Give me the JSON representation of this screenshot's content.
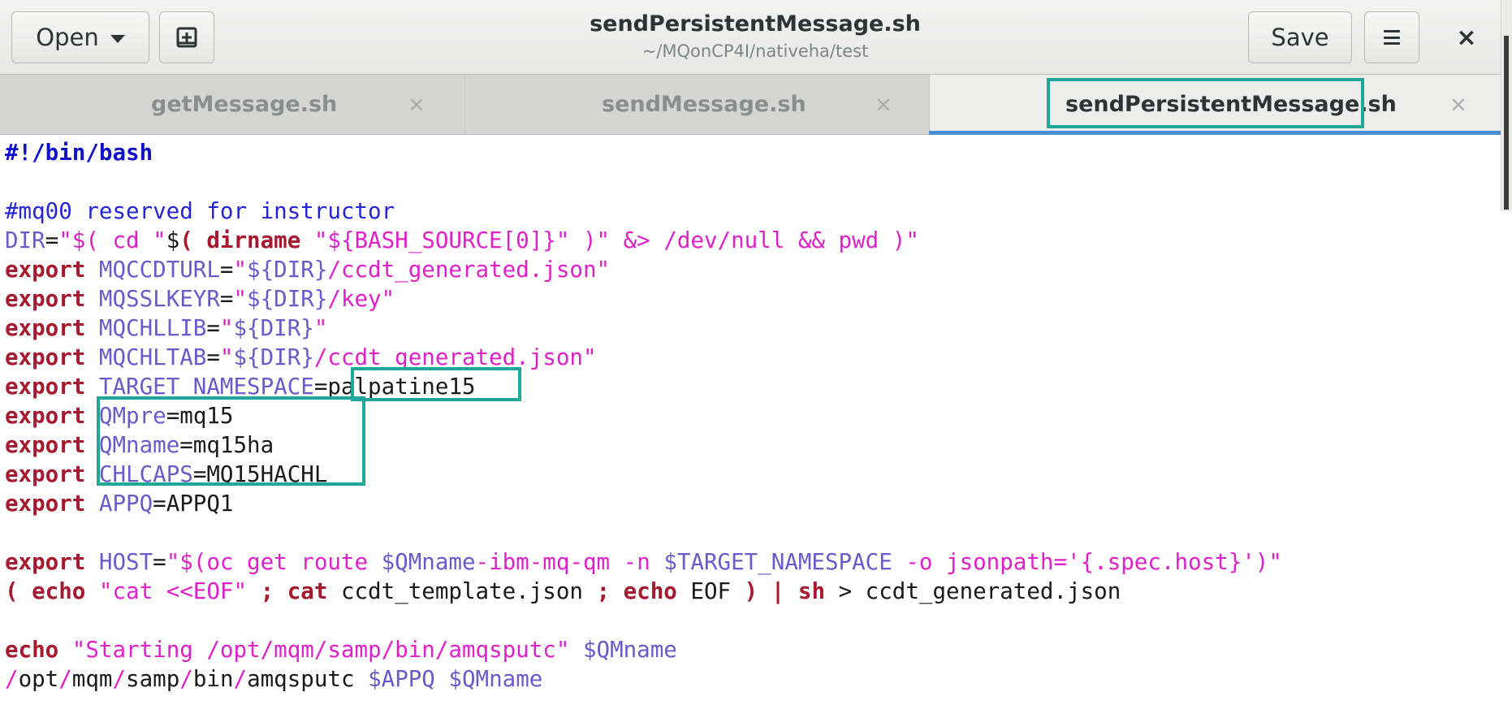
{
  "window": {
    "title": "sendPersistentMessage.sh",
    "path": "~/MQonCP4I/nativeha/test",
    "open_label": "Open",
    "save_label": "Save",
    "close_glyph": "×",
    "new_tab_icon": "new-tab-icon",
    "menu_icon": "hamburger-menu-icon"
  },
  "tabs": [
    {
      "label": "getMessage.sh",
      "active": false,
      "close_glyph": "×"
    },
    {
      "label": "sendMessage.sh",
      "active": false,
      "close_glyph": "×"
    },
    {
      "label": "sendPersistentMessage.sh",
      "active": true,
      "close_glyph": "×"
    }
  ],
  "colors": {
    "accent_tab": "#4a90d9",
    "highlight_box": "#1fa89a",
    "keyword": "#a6192e",
    "string": "#e020c8",
    "variable": "#6a5acd",
    "comment": "#2525d8"
  },
  "code_lines": [
    [
      {
        "c": "shb",
        "t": "#!/bin/bash"
      }
    ],
    [],
    [
      {
        "c": "cm",
        "t": "#mq00 reserved for instructor"
      }
    ],
    [
      {
        "c": "vr",
        "t": "DIR"
      },
      {
        "c": "pl",
        "t": "="
      },
      {
        "c": "st",
        "t": "\"$( cd \""
      },
      {
        "c": "pl",
        "t": "$"
      },
      {
        "c": "kw",
        "t": "( dirname "
      },
      {
        "c": "st",
        "t": "\"${BASH_SOURCE[0]}\" )\" &> /dev/null && pwd )\""
      }
    ],
    [
      {
        "c": "kw",
        "t": "export "
      },
      {
        "c": "vr",
        "t": "MQCCDTURL"
      },
      {
        "c": "pl",
        "t": "="
      },
      {
        "c": "st",
        "t": "\""
      },
      {
        "c": "vr",
        "t": "${DIR}"
      },
      {
        "c": "st",
        "t": "/ccdt_generated.json\""
      }
    ],
    [
      {
        "c": "kw",
        "t": "export "
      },
      {
        "c": "vr",
        "t": "MQSSLKEYR"
      },
      {
        "c": "pl",
        "t": "="
      },
      {
        "c": "st",
        "t": "\""
      },
      {
        "c": "vr",
        "t": "${DIR}"
      },
      {
        "c": "st",
        "t": "/key\""
      }
    ],
    [
      {
        "c": "kw",
        "t": "export "
      },
      {
        "c": "vr",
        "t": "MQCHLLIB"
      },
      {
        "c": "pl",
        "t": "="
      },
      {
        "c": "st",
        "t": "\""
      },
      {
        "c": "vr",
        "t": "${DIR}"
      },
      {
        "c": "st",
        "t": "\""
      }
    ],
    [
      {
        "c": "kw",
        "t": "export "
      },
      {
        "c": "vr",
        "t": "MQCHLTAB"
      },
      {
        "c": "pl",
        "t": "="
      },
      {
        "c": "st",
        "t": "\""
      },
      {
        "c": "vr",
        "t": "${DIR}"
      },
      {
        "c": "st",
        "t": "/ccdt_generated.json\""
      }
    ],
    [
      {
        "c": "kw",
        "t": "export "
      },
      {
        "c": "vr",
        "t": "TARGET_NAMESPACE"
      },
      {
        "c": "pl",
        "t": "=palpatine15"
      }
    ],
    [
      {
        "c": "kw",
        "t": "export "
      },
      {
        "c": "vr",
        "t": "QMpre"
      },
      {
        "c": "pl",
        "t": "=mq15"
      }
    ],
    [
      {
        "c": "kw",
        "t": "export "
      },
      {
        "c": "vr",
        "t": "QMname"
      },
      {
        "c": "pl",
        "t": "=mq15ha"
      }
    ],
    [
      {
        "c": "kw",
        "t": "export "
      },
      {
        "c": "vr",
        "t": "CHLCAPS"
      },
      {
        "c": "pl",
        "t": "=MQ15HACHL"
      }
    ],
    [
      {
        "c": "kw",
        "t": "export "
      },
      {
        "c": "vr",
        "t": "APPQ"
      },
      {
        "c": "pl",
        "t": "=APPQ1"
      }
    ],
    [],
    [
      {
        "c": "kw",
        "t": "export "
      },
      {
        "c": "vr",
        "t": "HOST"
      },
      {
        "c": "pl",
        "t": "="
      },
      {
        "c": "st",
        "t": "\"$(oc get route "
      },
      {
        "c": "vr",
        "t": "$QMname"
      },
      {
        "c": "st",
        "t": "-ibm-mq-qm -n "
      },
      {
        "c": "vr",
        "t": "$TARGET_NAMESPACE"
      },
      {
        "c": "st",
        "t": " -o jsonpath='{.spec.host}')\""
      }
    ],
    [
      {
        "c": "kw",
        "t": "( echo "
      },
      {
        "c": "st",
        "t": "\"cat <<EOF\""
      },
      {
        "c": "kw",
        "t": " ; cat "
      },
      {
        "c": "pl",
        "t": "ccdt_template.json "
      },
      {
        "c": "kw",
        "t": "; echo "
      },
      {
        "c": "pl",
        "t": "EOF "
      },
      {
        "c": "kw",
        "t": ") | sh "
      },
      {
        "c": "pl",
        "t": "> ccdt_generated.json"
      }
    ],
    [],
    [
      {
        "c": "kw",
        "t": "echo "
      },
      {
        "c": "st",
        "t": "\"Starting /opt/mqm/samp/bin/amqsputc\" "
      },
      {
        "c": "vr",
        "t": "$QMname"
      }
    ],
    [
      {
        "c": "st",
        "t": "/"
      },
      {
        "c": "pl",
        "t": "opt"
      },
      {
        "c": "st",
        "t": "/"
      },
      {
        "c": "pl",
        "t": "mqm"
      },
      {
        "c": "st",
        "t": "/"
      },
      {
        "c": "pl",
        "t": "samp"
      },
      {
        "c": "st",
        "t": "/"
      },
      {
        "c": "pl",
        "t": "bin"
      },
      {
        "c": "st",
        "t": "/"
      },
      {
        "c": "pl",
        "t": "amqsputc "
      },
      {
        "c": "vr",
        "t": "$APPQ $QMname"
      }
    ]
  ]
}
